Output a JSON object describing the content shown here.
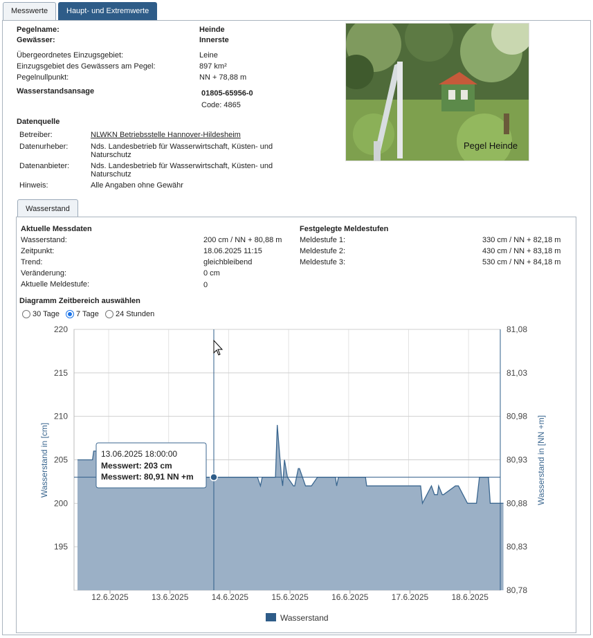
{
  "tabs": {
    "messwerte": "Messwerte",
    "haupt": "Haupt- und Extremwerte"
  },
  "info": {
    "pegelname_label": "Pegelname:",
    "pegelname": "Heinde",
    "gewaesser_label": "Gewässer:",
    "gewaesser": "Innerste",
    "einzugsgebiet_label": "Übergeordnetes Einzugsgebiet:",
    "einzugsgebiet": "Leine",
    "einzugsflaeche_label": "Einzugsgebiet des Gewässers am Pegel:",
    "einzugsflaeche": "897 km²",
    "nullpunkt_label": "Pegelnullpunkt:",
    "nullpunkt": "NN + 78,88 m",
    "ansage_label": "Wasserstandsansage",
    "ansage_phone": "01805-65956-0",
    "ansage_code": "Code: 4865"
  },
  "datenquelle": {
    "title": "Datenquelle",
    "betreiber_label": "Betreiber:",
    "betreiber": "NLWKN Betriebsstelle Hannover-Hildesheim",
    "urheber_label": "Datenurheber:",
    "urheber_1": "Nds. Landesbetrieb für Wasserwirtschaft, Küsten- und",
    "urheber_2": "Naturschutz",
    "anbieter_label": "Datenanbieter:",
    "anbieter_1": "Nds. Landesbetrieb für Wasserwirtschaft, Küsten- und",
    "anbieter_2": "Naturschutz",
    "hinweis_label": "Hinweis:",
    "hinweis": "Alle Angaben ohne Gewähr"
  },
  "photo_caption": "Pegel Heinde",
  "wasserstand_tab": "Wasserstand",
  "messdaten": {
    "title": "Aktuelle Messdaten",
    "wasserstand_label": "Wasserstand:",
    "wasserstand": "200 cm / NN + 80,88 m",
    "zeitpunkt_label": "Zeitpunkt:",
    "zeitpunkt": "18.06.2025 11:15",
    "trend_label": "Trend:",
    "trend": "gleichbleibend",
    "veraenderung_label": "Veränderung:",
    "veraenderung": "0 cm",
    "meldestufe_label": "Aktuelle Meldestufe:",
    "meldestufe": "0"
  },
  "meldestufen": {
    "title": "Festgelegte Meldestufen",
    "s1_label": "Meldestufe 1:",
    "s1": "330 cm / NN + 82,18 m",
    "s2_label": "Meldestufe 2:",
    "s2": "430 cm / NN + 83,18 m",
    "s3_label": "Meldestufe 3:",
    "s3": "530 cm / NN + 84,18 m"
  },
  "zeitbereich": {
    "title": "Diagramm Zeitbereich auswählen",
    "options": [
      "30 Tage",
      "7 Tage",
      "24 Stunden"
    ],
    "selected": "7 Tage"
  },
  "tooltip": {
    "time": "13.06.2025 18:00:00",
    "line1": "Messwert: 203 cm",
    "line2": "Messwert: 80,91 NN +m"
  },
  "colors": {
    "accent": "#2e5c88",
    "area": "#9bb0c6",
    "line": "#3a668f"
  },
  "chart_data": {
    "type": "area",
    "ylabel": "Wasserstand in [cm]",
    "y2label": "Wasserstand in [NN +m]",
    "ylim": [
      190,
      220
    ],
    "y2lim": [
      80.78,
      81.08
    ],
    "y_ticks": [
      "220",
      "215",
      "210",
      "205",
      "200",
      "195"
    ],
    "y2_ticks": [
      "81,08",
      "81,03",
      "80,98",
      "80,93",
      "80,88",
      "80,83",
      "80,78"
    ],
    "x_ticks": [
      "12.6.2025",
      "13.6.2025",
      "14.6.2025",
      "15.6.2025",
      "16.6.2025",
      "17.6.2025",
      "18.6.2025"
    ],
    "legend": [
      "Wasserstand"
    ],
    "series": [
      {
        "name": "Wasserstand",
        "x_days": [
          0,
          0.25,
          0.27,
          0.5,
          0.55,
          1.0,
          2.0,
          2.5,
          3.0,
          3.05,
          3.08,
          3.1,
          3.3,
          3.33,
          3.4,
          3.42,
          3.45,
          3.5,
          3.6,
          3.62,
          3.68,
          3.7,
          3.8,
          3.9,
          4.0,
          4.3,
          4.32,
          4.35,
          4.5,
          4.8,
          4.82,
          4.85,
          5.0,
          5.5,
          5.55,
          5.6,
          5.72,
          5.75,
          5.9,
          5.95,
          6.0,
          6.02,
          6.08,
          6.1,
          6.3,
          6.35,
          6.5,
          6.55,
          6.65,
          6.7,
          6.85,
          6.88,
          6.95,
          6.98,
          7.05,
          7.1
        ],
        "values": [
          205,
          205,
          206,
          206,
          203,
          203,
          203,
          203,
          203,
          202,
          203,
          203,
          203,
          209,
          203,
          202,
          205,
          203,
          202,
          202,
          204,
          204,
          202,
          202,
          203,
          203,
          202,
          203,
          203,
          203,
          202,
          202,
          202,
          202,
          202,
          202,
          202,
          200,
          202,
          201,
          201,
          202,
          201,
          201,
          202,
          202,
          200,
          200,
          200,
          203,
          203,
          200,
          200,
          200,
          200,
          200
        ]
      }
    ]
  }
}
